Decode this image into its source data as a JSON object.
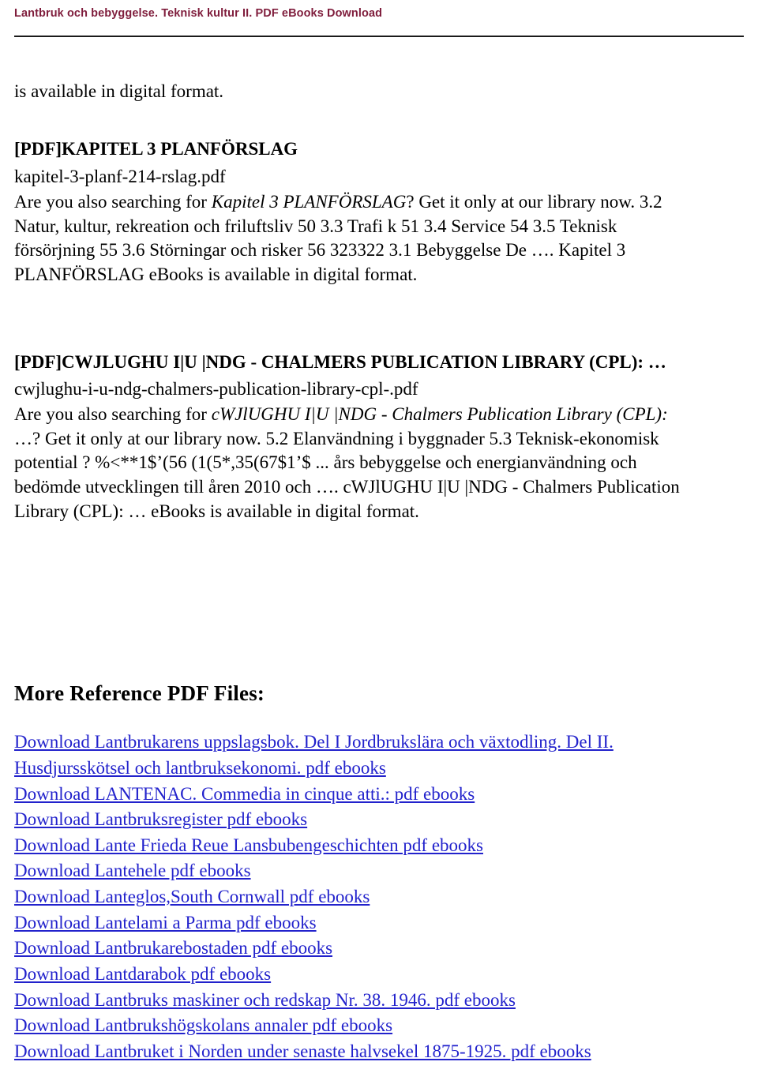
{
  "header": {
    "title": "Lantbruk och bebyggelse. Teknisk kultur II. PDF eBooks Download",
    "title_color": "#7f1d3c",
    "rule_color": "#1a1a1a"
  },
  "content": {
    "lead_line": "is available in digital format.",
    "pdf_entries": [
      {
        "heading": "[PDF]KAPITEL 3 PLANFÖRSLAG",
        "filename": "kapitel-3-planf-214-rslag.pdf",
        "body_lines": [
          {
            "pre": "Are you also searching for ",
            "italic": "Kapitel 3 PLANFÖRSLAG",
            "post": "? Get it only at our library now. 3.2"
          },
          {
            "pre": "Natur, kultur, rekreation och friluftsliv 50 3.3 Trafi k 51 3.4 Service 54 3.5 Teknisk",
            "italic": "",
            "post": ""
          },
          {
            "pre": "försörjning 55 3.6 Störningar och risker 56 323322 3.1 Bebyggelse De …. Kapitel 3",
            "italic": "",
            "post": ""
          },
          {
            "pre": "PLANFÖRSLAG eBooks is available in digital format.",
            "italic": "",
            "post": ""
          }
        ]
      },
      {
        "heading": "[PDF]CWJLUGHU I|U |NDG - CHALMERS PUBLICATION LIBRARY (CPL): …",
        "filename": "cwjlughu-i-u-ndg-chalmers-publication-library-cpl-.pdf",
        "body_lines": [
          {
            "pre": "Are you also searching for ",
            "italic": "cWJlUGHU I|U |NDG - Chalmers Publication Library (CPL):",
            "post": ""
          },
          {
            "pre": "…? Get it only at our library now. 5.2 Elanvändning i byggnader 5.3 Teknisk-ekonomisk",
            "italic": "",
            "post": ""
          },
          {
            "pre": "potential ? %<**1$’(56 (1(5*,35(67$1’$ ... års bebyggelse och energianvändning och",
            "italic": "",
            "post": ""
          },
          {
            "pre": "bedömde utvecklingen till åren 2010 och …. cWJlUGHU I|U |NDG - Chalmers Publication",
            "italic": "",
            "post": ""
          },
          {
            "pre": "Library (CPL): … eBooks is available in digital format.",
            "italic": "",
            "post": ""
          }
        ]
      }
    ]
  },
  "more_reference": {
    "heading": "More Reference PDF Files:",
    "link_color": "#2222cc",
    "links": [
      "Download Lantbrukarens uppslagsbok. Del I Jordbrukslära och växtodling. Del II.",
      "Husdjursskötsel och lantbruksekonomi. pdf ebooks",
      "Download LANTENAC. Commedia in cinque atti.: pdf ebooks",
      "Download Lantbruksregister pdf ebooks",
      "Download Lante Frieda Reue Lansbubengeschichten pdf ebooks",
      "Download Lantehele pdf ebooks",
      "Download Lanteglos,South Cornwall pdf ebooks",
      "Download Lantelami a Parma pdf ebooks",
      "Download Lantbrukarebostaden pdf ebooks",
      "Download Lantdarabok pdf ebooks",
      "Download Lantbruks maskiner och redskap Nr. 38. 1946. pdf ebooks",
      "Download Lantbrukshögskolans annaler pdf ebooks",
      "Download Lantbruket i Norden under senaste halvsekel 1875-1925. pdf ebooks"
    ]
  }
}
